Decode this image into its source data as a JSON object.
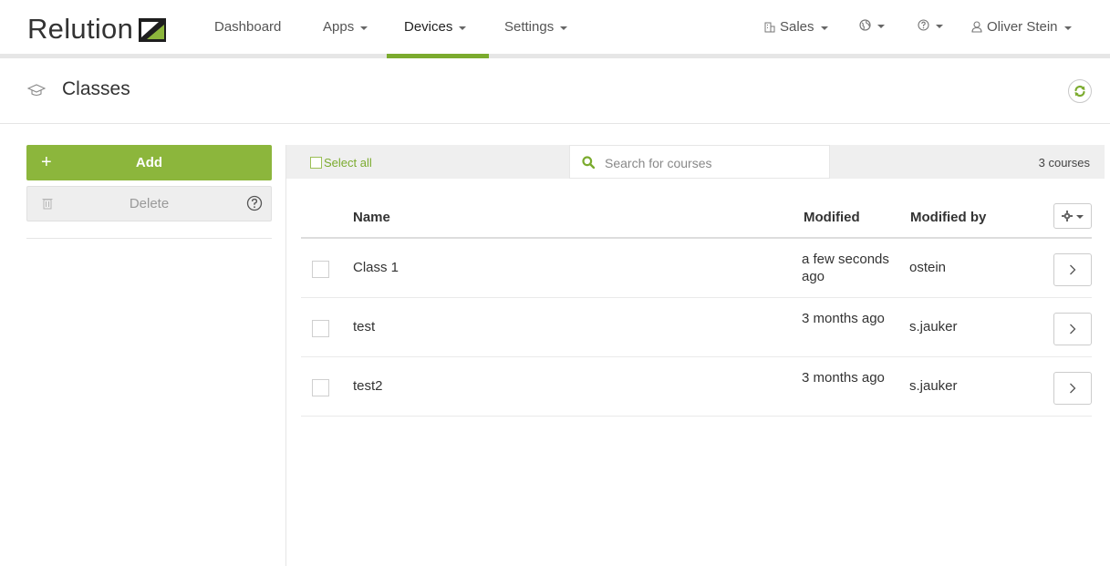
{
  "brand": {
    "name": "Relution"
  },
  "nav": {
    "dashboard": "Dashboard",
    "apps": "Apps",
    "devices": "Devices",
    "settings": "Settings",
    "org": "Sales",
    "user": "Oliver Stein"
  },
  "page": {
    "title": "Classes"
  },
  "actions": {
    "add": "Add",
    "delete": "Delete"
  },
  "toolbar": {
    "select_all": "Select all",
    "search_placeholder": "Search for courses",
    "count": "3 courses"
  },
  "table": {
    "headers": {
      "name": "Name",
      "modified": "Modified",
      "modified_by": "Modified by"
    },
    "rows": [
      {
        "name": "Class 1",
        "modified": "a few seconds ago",
        "modified_by": "ostein"
      },
      {
        "name": "test",
        "modified": "3 months ago",
        "modified_by": "s.jauker"
      },
      {
        "name": "test2",
        "modified": "3 months ago",
        "modified_by": "s.jauker"
      }
    ]
  },
  "colors": {
    "accent": "#8cb63c",
    "accent_dark": "#7bab2e"
  },
  "icons": [
    "graduation-cap-icon",
    "refresh-icon",
    "plus-icon",
    "trash-icon",
    "help-icon",
    "search-icon",
    "gear-icon",
    "chevron-right-icon",
    "globe-icon",
    "building-icon",
    "user-icon"
  ]
}
